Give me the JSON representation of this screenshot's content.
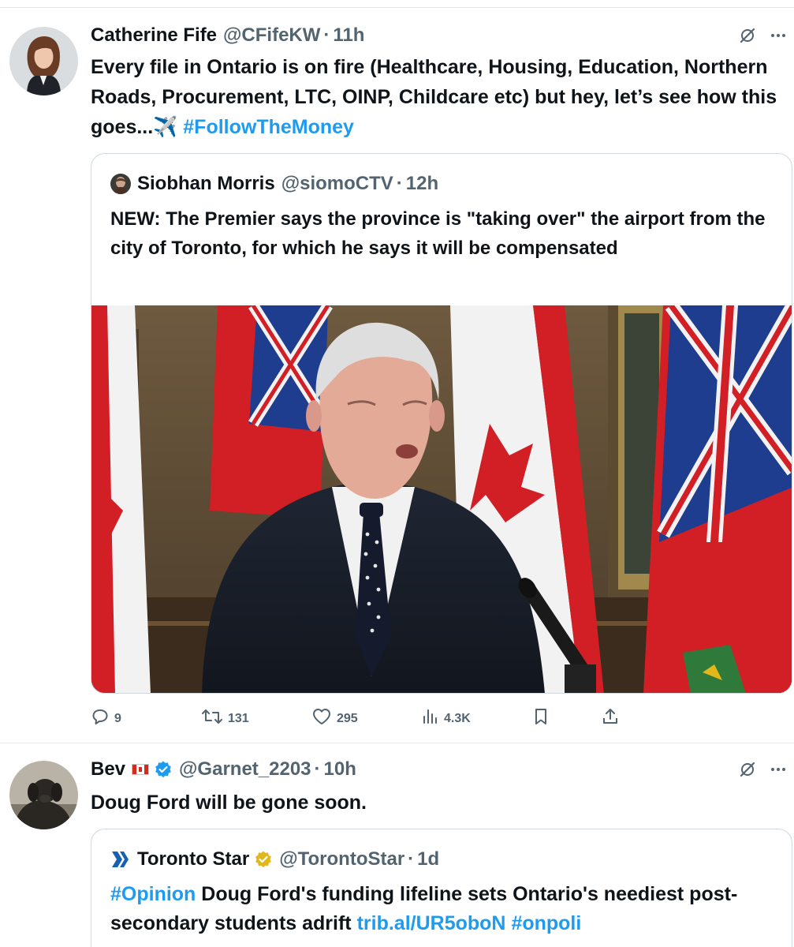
{
  "tweet1": {
    "name": "Catherine Fife",
    "handle": "@CFifeKW",
    "separator": "·",
    "time": "11h",
    "text_main": "Every file in Ontario is on fire (Healthcare, Housing, Education, Northern Roads, Procurement, LTC, OINP, Childcare etc) but hey, let’s see how this goes...",
    "emoji": "✈️",
    "hashtag": "#FollowTheMoney",
    "quote": {
      "name": "Siobhan Morris",
      "handle": "@siomoCTV",
      "separator": "·",
      "time": "12h",
      "text": "NEW: The Premier says the province is \"taking over\" the airport from the city of Toronto, for which he says it will be compensated"
    },
    "actions": {
      "replies": "9",
      "reposts": "131",
      "likes": "295",
      "views": "4.3K"
    }
  },
  "tweet2": {
    "name": "Bev",
    "handle": "@Garnet_2203",
    "separator": "·",
    "time": "10h",
    "text": "Doug Ford will be gone soon.",
    "quote": {
      "name": "Toronto Star",
      "handle": "@TorontoStar",
      "separator": "·",
      "time": "1d",
      "hashtag1": "#Opinion",
      "text": " Doug Ford's funding lifeline sets Ontario's neediest post-secondary students adrift ",
      "link": "trib.al/UR5oboN",
      "hashtag2": "#onpoli"
    }
  },
  "colors": {
    "link": "#1d9bf0",
    "secondary_text": "#536471",
    "border": "#cfd9de",
    "verified_blue": "#1d9bf0",
    "verified_gold": "#e2b719"
  },
  "icons": [
    "grok-icon",
    "more-icon",
    "reply-icon",
    "repost-icon",
    "like-icon",
    "views-icon",
    "bookmark-icon",
    "share-icon",
    "verified-badge-icon",
    "canada-flag-icon"
  ]
}
